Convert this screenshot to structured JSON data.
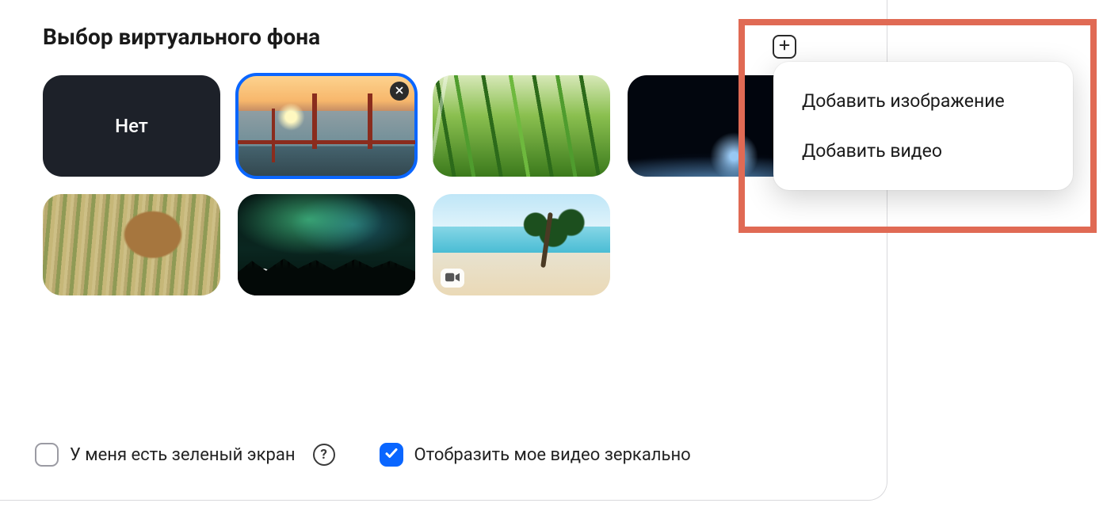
{
  "title": "Выбор виртуального фона",
  "add_button_icon": "plus-icon",
  "thumbnails": {
    "none_label": "Нет"
  },
  "options": {
    "green_screen_label": "У меня есть зеленый экран",
    "mirror_label": "Отобразить мое видео зеркально",
    "green_screen_checked": false,
    "mirror_checked": true
  },
  "menu": {
    "add_image": "Добавить изображение",
    "add_video": "Добавить видео"
  }
}
